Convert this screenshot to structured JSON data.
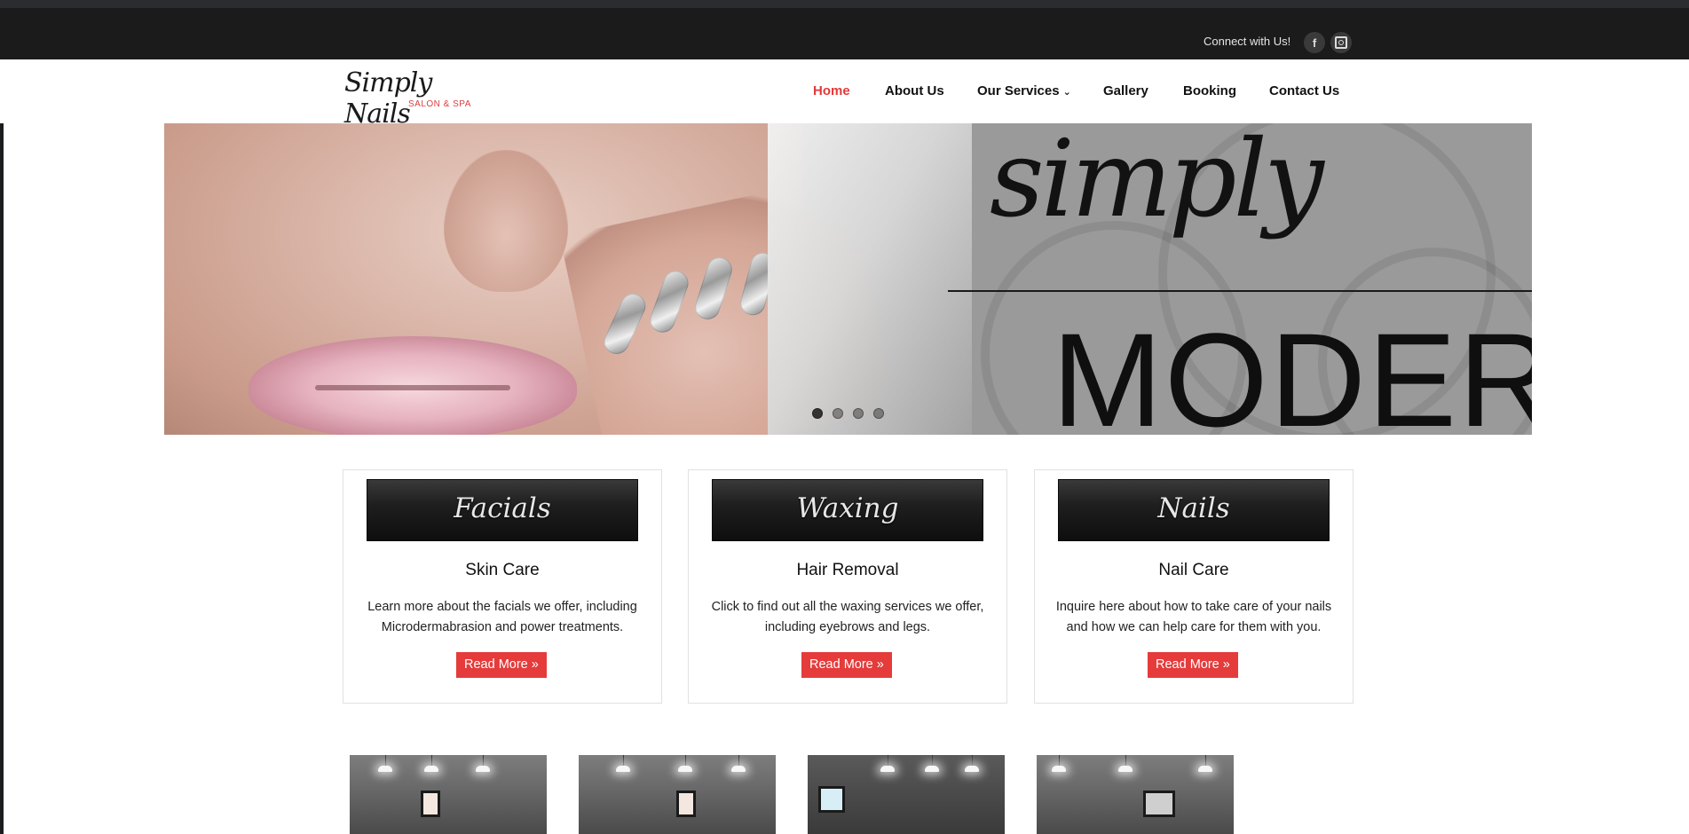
{
  "topbar": {
    "connect_text": "Connect with Us!",
    "social": [
      {
        "name": "facebook-icon",
        "glyph": "f"
      },
      {
        "name": "instagram-icon",
        "glyph": ""
      }
    ]
  },
  "header": {
    "logo": {
      "main": "Simply Nails",
      "sub": "SALON & SPA"
    },
    "nav": [
      {
        "label": "Home",
        "active": true
      },
      {
        "label": "About Us",
        "active": false
      },
      {
        "label": "Our Services",
        "active": false,
        "has_dropdown": true
      },
      {
        "label": "Gallery",
        "active": false
      },
      {
        "label": "Booking",
        "active": false
      },
      {
        "label": "Contact Us",
        "active": false
      }
    ],
    "chevron": "⌄"
  },
  "hero": {
    "headline_script": "simply",
    "headline_caps": "MODERN",
    "slides_total": 4,
    "active_slide": 1
  },
  "services": [
    {
      "banner": "Facials",
      "title": "Skin Care",
      "description": "Learn more about the facials we offer, including Microdermabrasion and power treatments.",
      "button": "Read More »"
    },
    {
      "banner": "Waxing",
      "title": "Hair Removal",
      "description": "Click to find out all the waxing services we offer, including eyebrows and legs.",
      "button": "Read More »"
    },
    {
      "banner": "Nails",
      "title": "Nail Care",
      "description": "Inquire here about how to take care of your nails and how we can help care for them with you.",
      "button": "Read More »"
    }
  ],
  "colors": {
    "accent": "#e53b3b",
    "topbar": "#1b1b1c",
    "nav_active": "#e23a3a"
  }
}
